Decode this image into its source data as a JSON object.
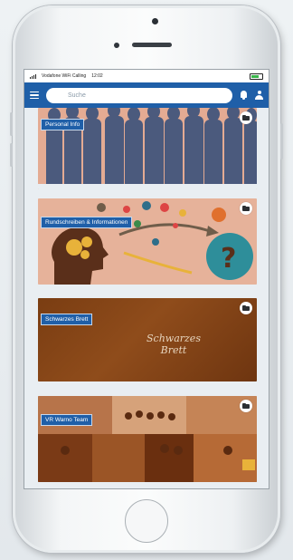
{
  "status_bar": {
    "carrier": "Vodafone WiFi Calling",
    "time": "12:02"
  },
  "app_bar": {
    "search_placeholder": "Suche"
  },
  "tiles": [
    {
      "label": "Personal Info",
      "icon": "folder-icon"
    },
    {
      "label": "Rundschreiben & Informationen",
      "icon": "folder-icon"
    },
    {
      "label": "Schwarzes Brett",
      "icon": "folder-icon",
      "chalk_text": "Schwarzes Brett"
    },
    {
      "label": "VR Warno Team",
      "icon": "folder-icon"
    }
  ],
  "colors": {
    "app_bar": "#1f5fa8",
    "label_bg": "#1f5fa8",
    "label_text": "#ffffff",
    "screen_bg": "#e9eef2"
  }
}
